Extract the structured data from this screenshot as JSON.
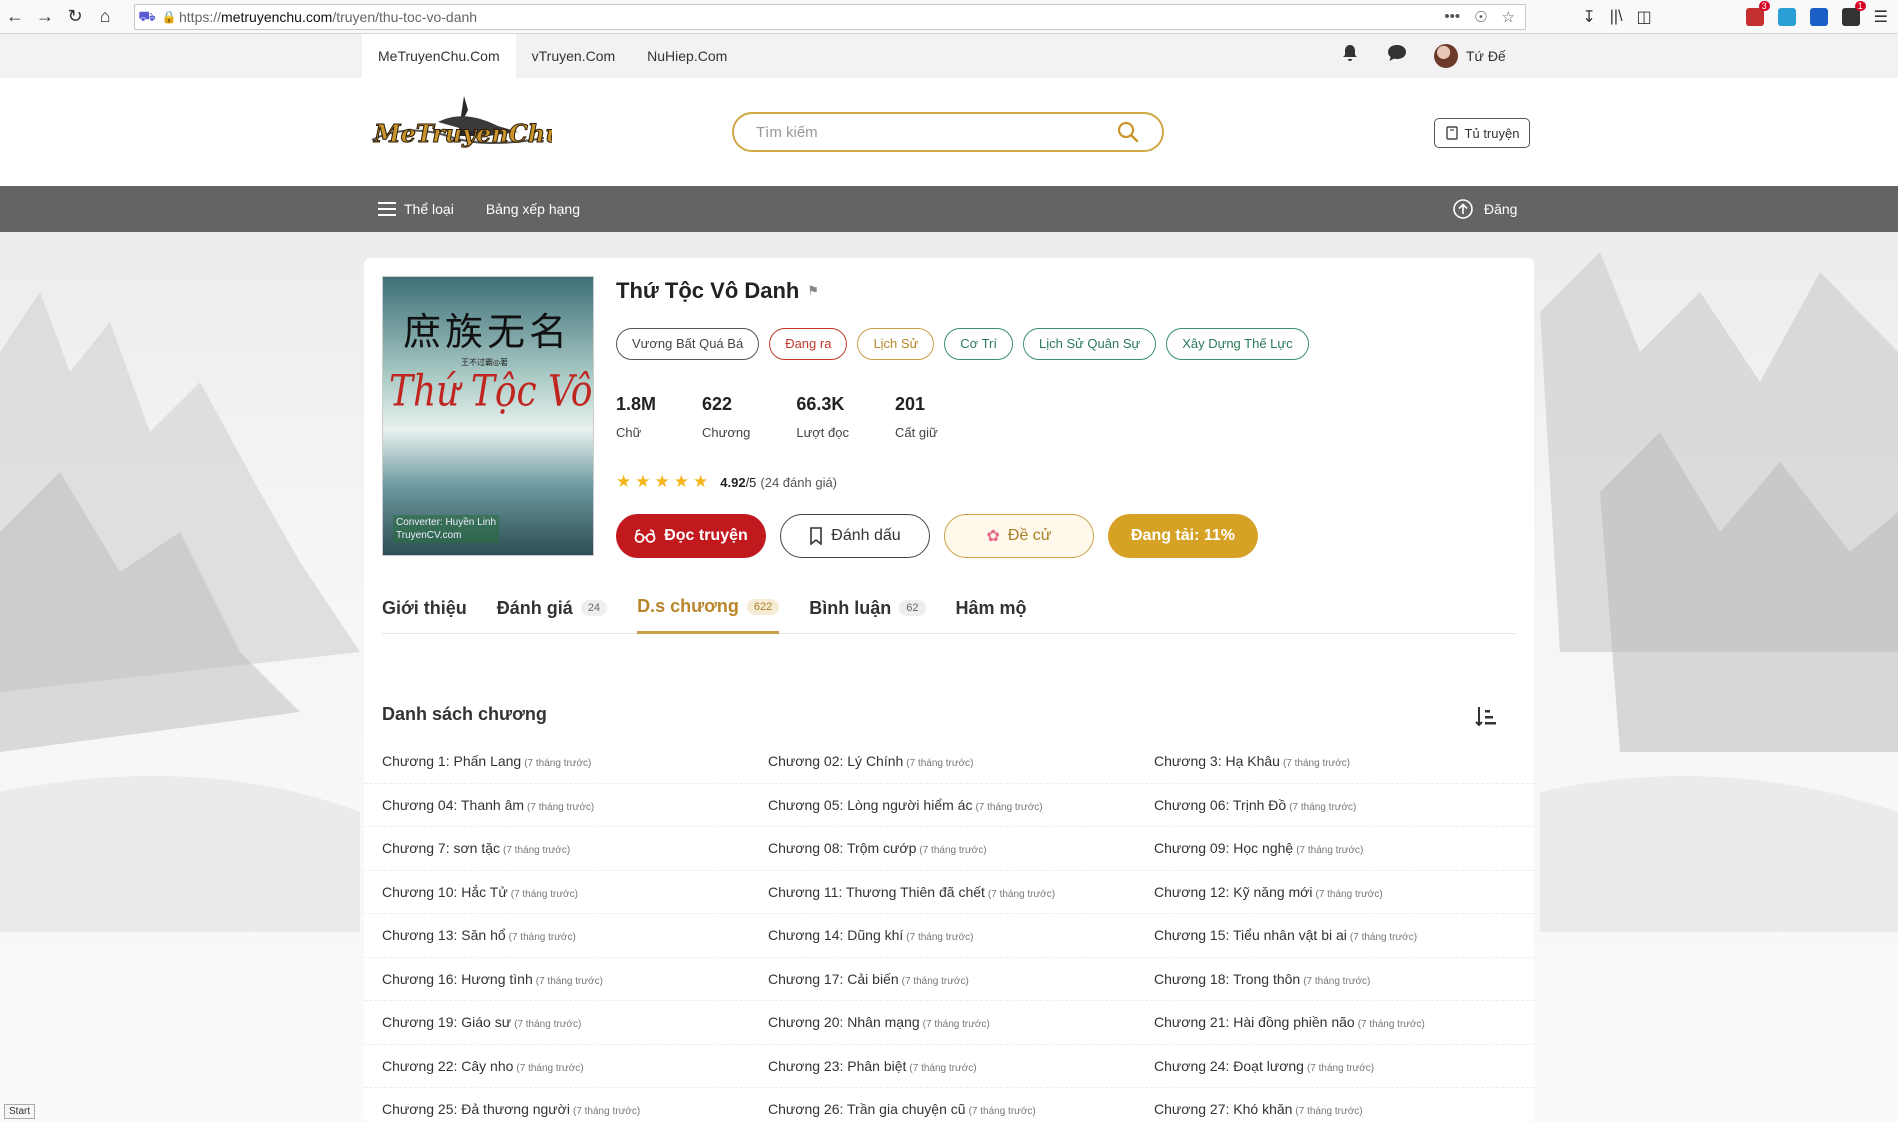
{
  "browser": {
    "url_prefix": "https://",
    "url_domain": "metruyenchu.com",
    "url_path": "/truyen/thu-toc-vo-danh",
    "ext_badge_1": "3",
    "ext_badge_2": "1"
  },
  "site_strip": {
    "tabs": [
      "MeTruyenChu.Com",
      "vTruyen.Com",
      "NuHiep.Com"
    ],
    "user_name": "Tứ Đế"
  },
  "header": {
    "search_placeholder": "Tìm kiếm",
    "bookshelf_label": "Tủ truyện"
  },
  "navbar": {
    "genres_label": "Thể loại",
    "ranking_label": "Bảng xếp hạng",
    "upload_label": "Đăng"
  },
  "book": {
    "title": "Thứ Tộc Vô Danh",
    "cover_text_cn": "庶族无名",
    "cover_text_vi": "Thứ Tộc Vô Danh",
    "cover_author_small": "王不过霸◎著",
    "cover_converter_1": "Converter: Huyền Linh",
    "cover_converter_2": "TruyenCV.com",
    "tags": {
      "author": "Vương Bất Quá Bá",
      "status": "Đang ra",
      "genre": "Lịch Sử",
      "t1": "Cơ Trí",
      "t2": "Lịch Sử Quân Sự",
      "t3": "Xây Dựng Thế Lực"
    },
    "stats": [
      {
        "value": "1.8M",
        "label": "Chữ"
      },
      {
        "value": "622",
        "label": "Chương"
      },
      {
        "value": "66.3K",
        "label": "Lượt đọc"
      },
      {
        "value": "201",
        "label": "Cất giữ"
      }
    ],
    "rating_score": "4.92",
    "rating_max": "/5",
    "rating_count": "(24 đánh giá)",
    "rating_stars": 5,
    "actions": {
      "read": "Đọc truyện",
      "mark": "Đánh dấu",
      "vote": "Đề cử",
      "upload": "Đang tải: 11%"
    }
  },
  "tabs": [
    {
      "label": "Giới thiệu",
      "count": ""
    },
    {
      "label": "Đánh giá",
      "count": "24"
    },
    {
      "label": "D.s chương",
      "count": "622"
    },
    {
      "label": "Bình luận",
      "count": "62"
    },
    {
      "label": "Hâm mộ",
      "count": ""
    }
  ],
  "chapter_list": {
    "title": "Danh sách chương",
    "time_label": "(7 tháng trước)",
    "rows": [
      [
        "Chương 1: Phấn Lang",
        "Chương 02: Lý Chính",
        "Chương 3: Hạ Khâu"
      ],
      [
        "Chương 04: Thanh âm",
        "Chương 05: Lòng người hiểm ác",
        "Chương 06: Trịnh Đồ"
      ],
      [
        "Chương 7: sơn tặc",
        "Chương 08: Trộm cướp",
        "Chương 09: Học nghệ"
      ],
      [
        "Chương 10: Hắc Tử",
        "Chương 11: Thương Thiên đã chết",
        "Chương 12: Kỹ năng mới"
      ],
      [
        "Chương 13: Săn hổ",
        "Chương 14: Dũng khí",
        "Chương 15: Tiểu nhân vật bi ai"
      ],
      [
        "Chương 16: Hương tình",
        "Chương 17: Cải biến",
        "Chương 18: Trong thôn"
      ],
      [
        "Chương 19: Giáo sư",
        "Chương 20: Nhân mạng",
        "Chương 21: Hài đồng phiền não"
      ],
      [
        "Chương 22: Cây nho",
        "Chương 23: Phân biệt",
        "Chương 24: Đoạt lương"
      ],
      [
        "Chương 25: Đả thương người",
        "Chương 26: Trần gia chuyện cũ",
        "Chương 27: Khó khăn"
      ]
    ]
  },
  "status_bar": {
    "start_label": "Start"
  }
}
